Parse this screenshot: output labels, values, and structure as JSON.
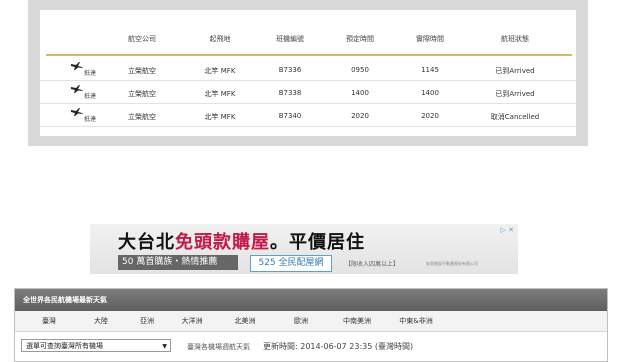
{
  "flight_table": {
    "headers": [
      "航空公司",
      "起飛地",
      "班機編號",
      "預定時間",
      "實際時間",
      "航班狀態"
    ],
    "rows": [
      {
        "direction": "抵達",
        "airline": "立榮航空",
        "origin": "北竿 MFK",
        "flight": "B7336",
        "scheduled": "0950",
        "actual": "1145",
        "status": "已到Arrived"
      },
      {
        "direction": "抵達",
        "airline": "立榮航空",
        "origin": "北竿 MFK",
        "flight": "B7338",
        "scheduled": "1400",
        "actual": "1400",
        "status": "已到Arrived"
      },
      {
        "direction": "抵達",
        "airline": "立榮航空",
        "origin": "北竿 MFK",
        "flight": "B7340",
        "scheduled": "2020",
        "actual": "2020",
        "status": "取消Cancelled"
      }
    ],
    "accent_line_color": "#d4b95e"
  },
  "ad": {
    "headline_pre": "大台北",
    "headline_hl": "免頭款購屋",
    "headline_post": "。平價居住",
    "pill1": "50 萬首購族・熱情推薦",
    "pill2": "525 全民配屋網",
    "small1": "【限收入四萬以上】",
    "small2": "安家總部不動產經紀有限公司",
    "icons": "▷ ✕",
    "highlight_color": "#c41a4a"
  },
  "weather": {
    "title": "全世界各民航機場最新天氣",
    "tabs": [
      "臺灣",
      "大陸",
      "亞洲",
      "大洋洲",
      "北美洲",
      "歐洲",
      "中南美洲",
      "中東&非洲"
    ],
    "select_value": "選單可查詢臺灣所有機場",
    "select_caret": "▼",
    "hint": "臺灣各機場週航天氣",
    "update_text": "更新時間: 2014-06-07 23:35 (臺灣時間)"
  }
}
